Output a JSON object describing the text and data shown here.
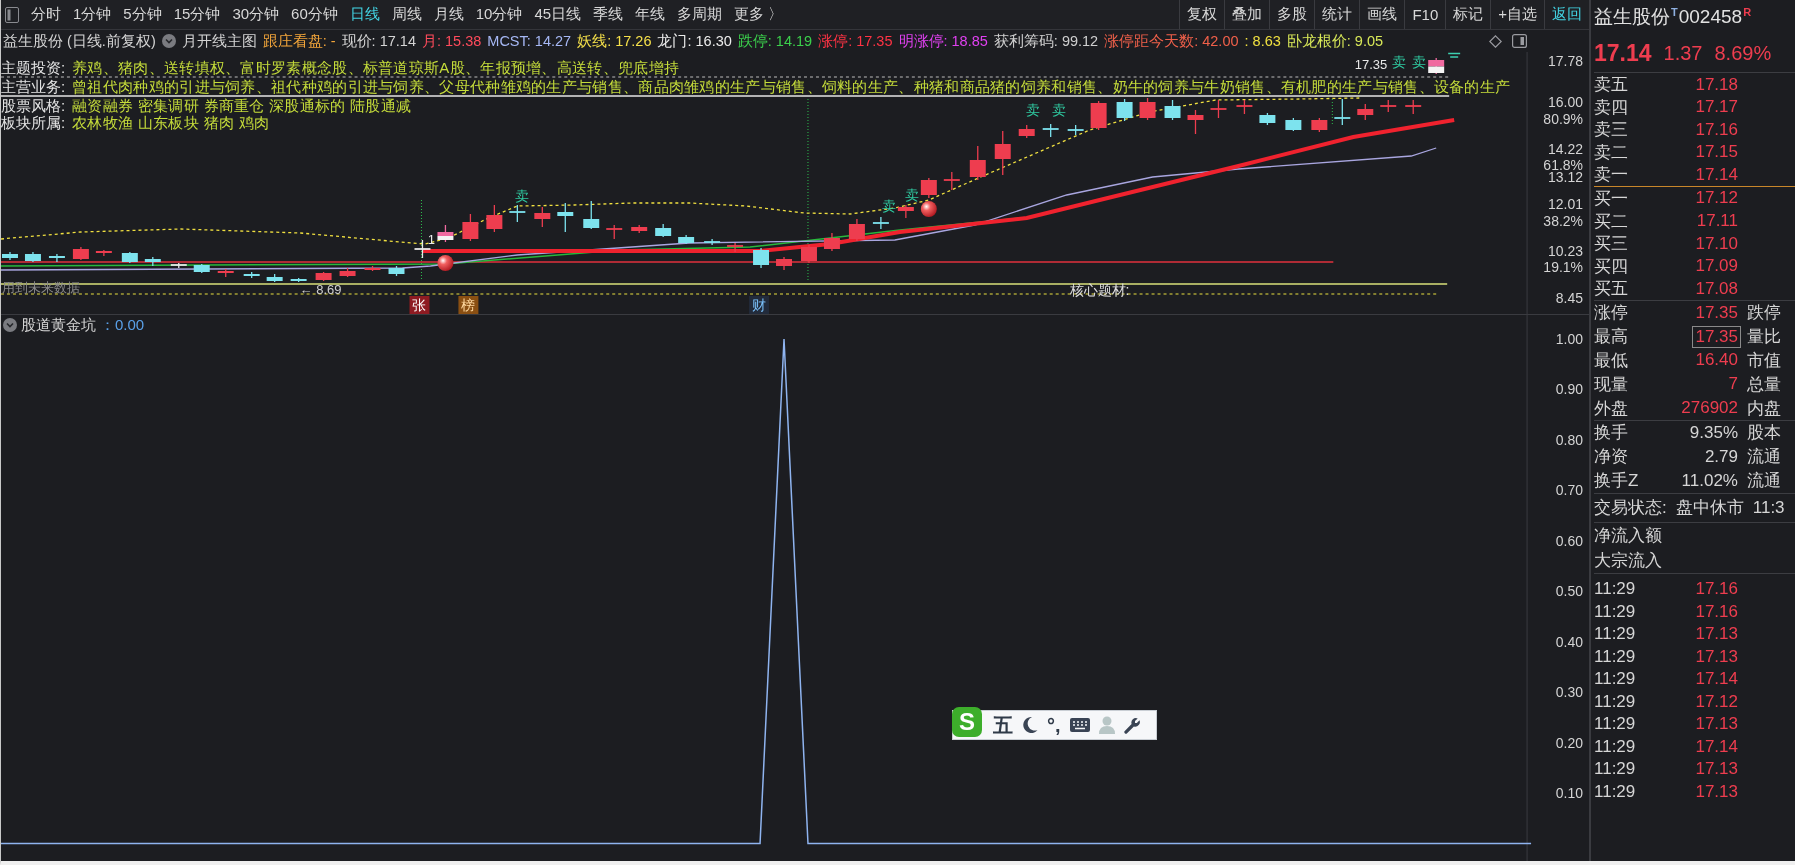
{
  "toolbar": {
    "periods": [
      {
        "label": "分时",
        "selected": false
      },
      {
        "label": "1分钟",
        "selected": false
      },
      {
        "label": "5分钟",
        "selected": false
      },
      {
        "label": "15分钟",
        "selected": false
      },
      {
        "label": "30分钟",
        "selected": false
      },
      {
        "label": "60分钟",
        "selected": false
      },
      {
        "label": "日线",
        "selected": true
      },
      {
        "label": "周线",
        "selected": false
      },
      {
        "label": "月线",
        "selected": false
      },
      {
        "label": "10分钟",
        "selected": false
      },
      {
        "label": "45日线",
        "selected": false
      },
      {
        "label": "季线",
        "selected": false
      },
      {
        "label": "年线",
        "selected": false
      },
      {
        "label": "多周期",
        "selected": false
      },
      {
        "label": "更多 〉",
        "selected": false
      }
    ],
    "actions": [
      {
        "label": "复权",
        "highlighted": false
      },
      {
        "label": "叠加",
        "highlighted": false
      },
      {
        "label": "多股",
        "highlighted": false
      },
      {
        "label": "统计",
        "highlighted": false
      },
      {
        "label": "画线",
        "highlighted": false
      },
      {
        "label": "F10",
        "highlighted": false
      },
      {
        "label": "标记",
        "highlighted": false
      },
      {
        "label": "+自选",
        "highlighted": false
      },
      {
        "label": "返回",
        "highlighted": true
      }
    ]
  },
  "chart_header": {
    "title": "益生股份 (日线.前复权)",
    "template": "月开线主图",
    "indicators": [
      {
        "text": "跟庄看盘: -",
        "color": "#f2a53a"
      },
      {
        "text": "现价: 17.14",
        "color": "#d4d4d4"
      },
      {
        "text": "月: 15.38",
        "color": "#ff4b5c"
      },
      {
        "text": "MCST: 14.27",
        "color": "#a6b8f5"
      },
      {
        "text": "妖线: 17.26",
        "color": "#f5e04a"
      },
      {
        "text": "龙门: 16.30",
        "color": "#ececec"
      },
      {
        "text": "跌停: 14.19",
        "color": "#3bd04c"
      },
      {
        "text": "涨停: 17.35",
        "color": "#ff3344"
      },
      {
        "text": "明涨停: 18.85",
        "color": "#e040f0"
      },
      {
        "text": "获利筹码: 99.12",
        "color": "#cfcfcf"
      },
      {
        "text": "涨停距今天数: 42.00",
        "color": "#f0604a"
      },
      {
        "text": ": 8.63",
        "color": "#f0e040"
      },
      {
        "text": "卧龙根价: 9.05",
        "color": "#d8e858"
      }
    ]
  },
  "info_rows": [
    {
      "label": "主题投资:",
      "text": "养鸡、猪肉、送转填权、富时罗素概念股、标普道琼斯A股、年报预增、高送转、兜底增持"
    },
    {
      "label": "主营业务:",
      "text": "曾祖代肉种鸡的引进与饲养、祖代种鸡的引进与饲养、父母代种雏鸡的生产与销售、商品肉雏鸡的生产与销售、饲料的生产、种猪和商品猪的饲养和销售、奶牛的饲养与牛奶销售、有机肥的生产与销售、设备的生产"
    },
    {
      "label": "股票风格:",
      "text": "融资融券 密集调研 券商重仓 深股通标的 陆股通减"
    },
    {
      "label": "板块所属:",
      "text": "农林牧渔 山东板块 猪肉 鸡肉"
    }
  ],
  "main_chart": {
    "axis_labels": [
      "17.78",
      "16.00",
      "80.9%",
      "14.22",
      "61.8%",
      "13.12",
      "12.01",
      "38.2%",
      "10.23",
      "19.1%",
      "8.45"
    ],
    "signals": [
      {
        "text": "卖"
      },
      {
        "text": "卖"
      },
      {
        "text": "卖"
      },
      {
        "text": "卖"
      },
      {
        "text": "卖"
      },
      {
        "text": "卖"
      },
      {
        "text": "卖"
      }
    ],
    "cross_label": "1",
    "low_label": "← 8.69",
    "high_label": "17.35",
    "future_note": "用到未来数据",
    "theme_note": "核心题材:",
    "event_tags": [
      {
        "text": "张",
        "kind": "limit-up"
      },
      {
        "text": "榜",
        "kind": "ranking"
      },
      {
        "text": "财",
        "kind": "finance"
      }
    ]
  },
  "indicator_panel": {
    "name": "股道黄金坑",
    "value": "：0.00",
    "axis_labels": [
      "1.00",
      "0.90",
      "0.80",
      "0.70",
      "0.60",
      "0.50",
      "0.40",
      "0.30",
      "0.20",
      "0.10"
    ]
  },
  "quote": {
    "name": "益生股份",
    "t_mark": "T",
    "code": "002458",
    "r_mark": "R",
    "price": "17.14",
    "change": "1.37",
    "change_pct": "8.69%",
    "asks": [
      {
        "label": "卖五",
        "price": "17.18"
      },
      {
        "label": "卖四",
        "price": "17.17"
      },
      {
        "label": "卖三",
        "price": "17.16"
      },
      {
        "label": "卖二",
        "price": "17.15"
      },
      {
        "label": "卖一",
        "price": "17.14"
      }
    ],
    "bids": [
      {
        "label": "买一",
        "price": "17.12"
      },
      {
        "label": "买二",
        "price": "17.11"
      },
      {
        "label": "买三",
        "price": "17.10"
      },
      {
        "label": "买四",
        "price": "17.09"
      },
      {
        "label": "买五",
        "price": "17.08"
      }
    ],
    "price_stats": [
      {
        "label": "涨停",
        "value": "17.35",
        "color": "#ee3d4f",
        "side_label": "跌停",
        "highlighted": false
      },
      {
        "label": "最高",
        "value": "17.35",
        "color": "#ee3d4f",
        "side_label": "量比",
        "highlighted": true
      },
      {
        "label": "最低",
        "value": "16.40",
        "color": "#ee3d4f",
        "side_label": "市值",
        "highlighted": false
      },
      {
        "label": "现量",
        "value": "7",
        "color": "#ee3d4f",
        "side_label": "总量",
        "highlighted": false
      },
      {
        "label": "外盘",
        "value": "276902",
        "color": "#ee3d4f",
        "side_label": "内盘",
        "highlighted": false
      }
    ],
    "share_stats": [
      {
        "label": "换手",
        "value": "9.35%",
        "color": "#d6d6d6",
        "side_label": "股本"
      },
      {
        "label": "净资",
        "value": "2.79",
        "color": "#d6d6d6",
        "side_label": "流通"
      },
      {
        "label": "换手Z",
        "value": "11.02%",
        "color": "#d6d6d6",
        "side_label": "流通"
      }
    ],
    "status": {
      "label": "交易状态:",
      "value": "盘中休市",
      "time": "11:3"
    },
    "flows": [
      "净流入额",
      "大宗流入"
    ],
    "trades": [
      {
        "time": "11:29",
        "price": "17.16"
      },
      {
        "time": "11:29",
        "price": "17.16"
      },
      {
        "time": "11:29",
        "price": "17.13"
      },
      {
        "time": "11:29",
        "price": "17.13"
      },
      {
        "time": "11:29",
        "price": "17.14"
      },
      {
        "time": "11:29",
        "price": "17.12"
      },
      {
        "time": "11:29",
        "price": "17.13"
      },
      {
        "time": "11:29",
        "price": "17.14"
      },
      {
        "time": "11:29",
        "price": "17.13"
      },
      {
        "time": "11:29",
        "price": "17.13"
      }
    ]
  },
  "ime_bar": {
    "logo": "S",
    "mode": "五",
    "punctuation": "°,"
  }
}
